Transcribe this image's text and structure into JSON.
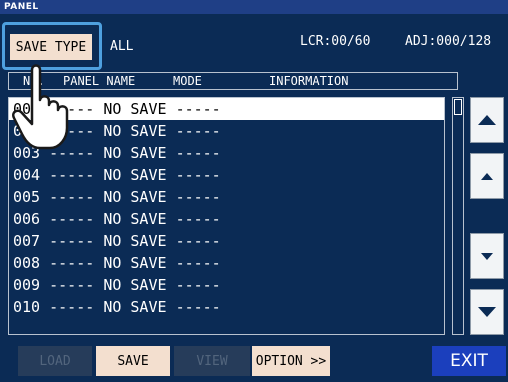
{
  "window": {
    "title": "PANEL"
  },
  "save_type": {
    "button_label": "SAVE TYPE",
    "value": "ALL"
  },
  "counters": {
    "lcr": "LCR:00/60",
    "adj": "ADJ:000/128"
  },
  "columns": {
    "no": "No.",
    "panel_name": "PANEL NAME",
    "mode": "MODE",
    "information": "INFORMATION"
  },
  "rows": [
    {
      "no": "001",
      "name": "-----",
      "mode": "NO SAVE",
      "info": "-----"
    },
    {
      "no": "002",
      "name": "-----",
      "mode": "NO SAVE",
      "info": "-----"
    },
    {
      "no": "003",
      "name": "-----",
      "mode": "NO SAVE",
      "info": "-----"
    },
    {
      "no": "004",
      "name": "-----",
      "mode": "NO SAVE",
      "info": "-----"
    },
    {
      "no": "005",
      "name": "-----",
      "mode": "NO SAVE",
      "info": "-----"
    },
    {
      "no": "006",
      "name": "-----",
      "mode": "NO SAVE",
      "info": "-----"
    },
    {
      "no": "007",
      "name": "-----",
      "mode": "NO SAVE",
      "info": "-----"
    },
    {
      "no": "008",
      "name": "-----",
      "mode": "NO SAVE",
      "info": "-----"
    },
    {
      "no": "009",
      "name": "-----",
      "mode": "NO SAVE",
      "info": "-----"
    },
    {
      "no": "010",
      "name": "-----",
      "mode": "NO SAVE",
      "info": "-----"
    }
  ],
  "buttons": {
    "load": "LOAD",
    "save": "SAVE",
    "view": "VIEW",
    "option": "OPTION >>",
    "exit": "EXIT"
  },
  "colors": {
    "background": "#0b2b55",
    "accent": "#4ea0df",
    "button": "#f3dfcf",
    "exit": "#1b3fbd"
  }
}
